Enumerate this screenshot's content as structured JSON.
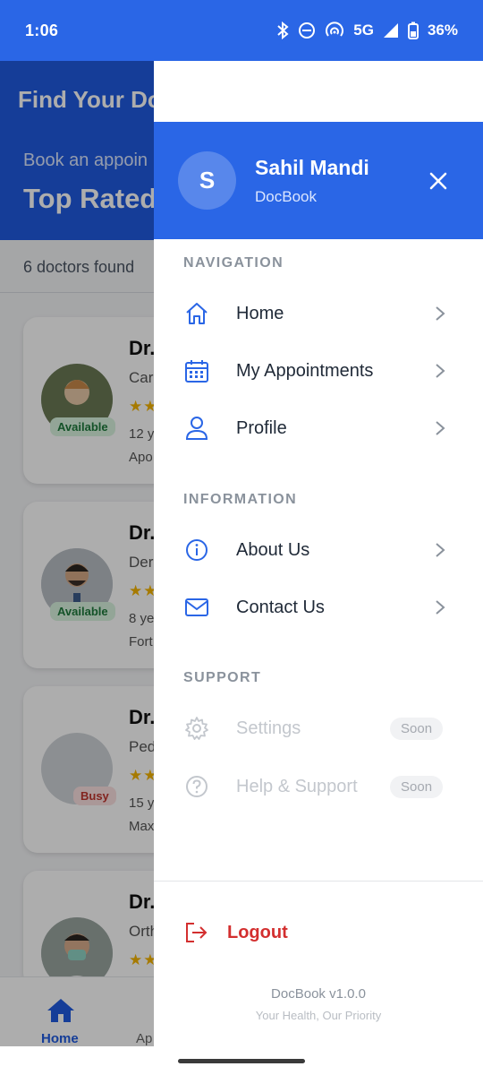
{
  "status_bar": {
    "time": "1:06",
    "network": "5G",
    "battery": "36%"
  },
  "background": {
    "header_title": "Find Your Do",
    "header_subtitle": "Book an appoin",
    "header_heading": "Top Rated",
    "found_text": "6 doctors found",
    "cards": [
      {
        "name": "Dr.",
        "spec": "Car",
        "rating": "★★",
        "years": "12 y",
        "hospital": "Apo",
        "status": "Available"
      },
      {
        "name": "Dr.",
        "spec": "Der",
        "rating": "★★",
        "years": "8 ye",
        "hospital": "Fort",
        "status": "Available"
      },
      {
        "name": "Dr.",
        "spec": "Ped",
        "rating": "★★",
        "years": "15 y",
        "hospital": "Max",
        "status": "Busy"
      },
      {
        "name": "Dr.",
        "spec": "Orth",
        "rating": "★★",
        "years": "",
        "hospital": "",
        "status": ""
      }
    ],
    "bottom_nav": {
      "home": "Home",
      "appointments": "Ap"
    }
  },
  "drawer": {
    "avatar_letter": "S",
    "user_name": "Sahil Mandi",
    "app_name": "DocBook",
    "sections": {
      "navigation": "NAVIGATION",
      "information": "INFORMATION",
      "support": "SUPPORT"
    },
    "items": {
      "home": "Home",
      "appointments": "My Appointments",
      "profile": "Profile",
      "about": "About Us",
      "contact": "Contact Us",
      "settings": "Settings",
      "help": "Help & Support"
    },
    "soon_badge": "Soon",
    "logout": "Logout",
    "version": "DocBook v1.0.0",
    "tagline": "Your Health, Our Priority"
  },
  "colors": {
    "primary": "#2a66e6",
    "logout": "#d32f2f",
    "available": "#1e7a3c",
    "busy": "#c0352e"
  }
}
